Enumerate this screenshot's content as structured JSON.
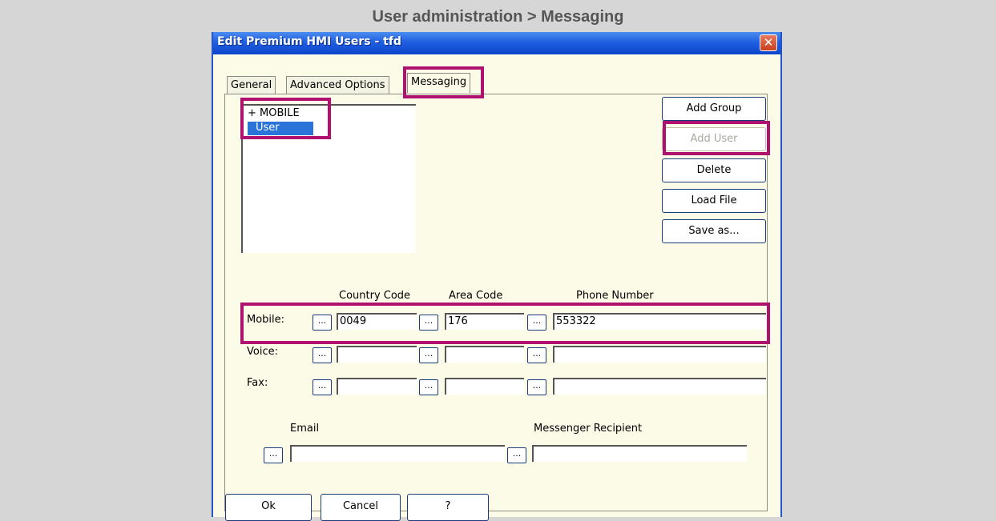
{
  "page_heading": "User administration > Messaging",
  "window": {
    "title": "Edit Premium HMI Users - tfd",
    "close_glyph": "✕"
  },
  "tabs": [
    {
      "label": "General"
    },
    {
      "label": "Advanced Options"
    },
    {
      "label": "Messaging"
    }
  ],
  "tree": {
    "group": "+ MOBILE",
    "user": "User"
  },
  "side_buttons": {
    "add_group": "Add Group",
    "add_user": "Add User",
    "delete": "Delete",
    "load_file": "Load File",
    "save_as": "Save as..."
  },
  "columns": {
    "country_code": "Country Code",
    "area_code": "Area Code",
    "phone_number": "Phone Number"
  },
  "browse_label": "...",
  "rows": {
    "mobile": {
      "label": "Mobile:",
      "country_code": "0049",
      "area_code": "176",
      "phone_number": "553322"
    },
    "voice": {
      "label": "Voice:",
      "country_code": "",
      "area_code": "",
      "phone_number": ""
    },
    "fax": {
      "label": "Fax:",
      "country_code": "",
      "area_code": "",
      "phone_number": ""
    }
  },
  "email": {
    "label": "Email",
    "value": ""
  },
  "messenger": {
    "label": "Messenger Recipient",
    "value": ""
  },
  "footer_buttons": {
    "ok": "Ok",
    "cancel": "Cancel",
    "help": "?"
  },
  "colors": {
    "highlight": "#b0106e",
    "titlebar": "#0c45cc",
    "selection": "#2a73d8",
    "dialog_bg": "#fbfbe7"
  }
}
